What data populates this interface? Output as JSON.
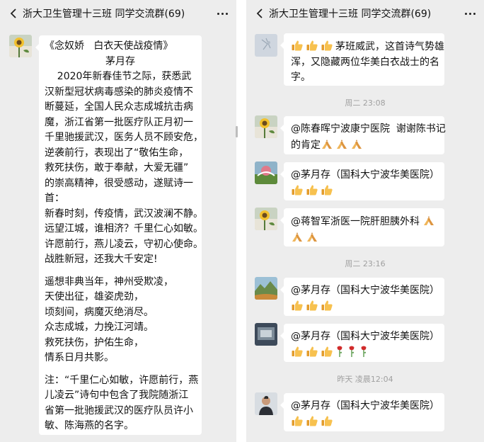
{
  "left": {
    "title": "浙大卫生管理十三班 同学交流群(69)",
    "poem": [
      "《念奴娇   白衣天使战疫情》",
      "茅月存",
      "    2020年新春佳节之际，获悉武",
      "汉新型冠状病毒感染的肺炎疫情不",
      "断蔓延，全国人民众志成城抗击病",
      "魔，浙江省第一批医疗队正月初一",
      "千里驰援武汉，医务人员不顾安危，",
      "逆袭前行，表现出了“敬佑生命，",
      "救死扶伤，敢于奉献，大爱无疆”",
      "的崇高精神，很受感动，遂赋诗一",
      "首：",
      "新春时刻，传疫情，武汉波澜不静。",
      "远望江城，谁相济？千里仁心如敏。",
      "许愿前行，燕儿凌云，守初心使命。",
      "战胜新冠，还我大千安定!",
      "",
      "遥想非典当年，神州受欺凌，",
      "天使出征，雄姿虎劲，",
      "顷刻间，病魔灭绝消尽。",
      "众志成城，力挽江河靖。",
      "救死扶伤，护佑生命，",
      "情系日月共影。",
      "",
      "注：“千里仁心如敏，许愿前行，燕",
      "儿凌云”诗句中包含了我院随浙江",
      "省第一批驰援武汉的医疗队员许小",
      "敏、陈海燕的名字。"
    ]
  },
  "right": {
    "title": "浙大卫生管理十三班 同学交流群(69)",
    "messages": [
      {
        "line1": "茅班威武，这首诗气势雄",
        "line2": "浑，又隐藏两位华美白衣战士的名",
        "line3": "字。"
      },
      {
        "line1": "@陈春晖宁波康宁医院  谢谢陈书记",
        "line2": "的肯定"
      },
      {
        "line1": "@茅月存（国科大宁波华美医院）"
      },
      {
        "line1": "@蒋智军浙医一院肝胆胰外科"
      },
      {
        "line1": "@茅月存（国科大宁波华美医院）"
      },
      {
        "line1": "@茅月存（国科大宁波华美医院）"
      },
      {
        "line1": "@茅月存（国科大宁波华美医院）"
      }
    ],
    "timestamps": [
      "周二 23:08",
      "周二 23:16",
      "昨天 凌晨12:04"
    ]
  },
  "colors": {
    "background": "#ededed",
    "bubble": "#ffffff",
    "timestamp": "#a0a0a0",
    "thumb": "#f2b544",
    "pray": "#e8a24a",
    "rose": "#d12b2b"
  },
  "icons": [
    "back-icon",
    "more-icon",
    "thumbs-up-icon",
    "pray-icon",
    "rose-icon"
  ]
}
